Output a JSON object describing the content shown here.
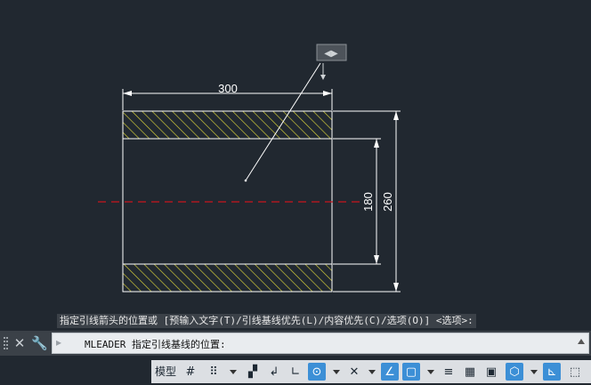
{
  "drawing": {
    "dim_width": "300",
    "dim_inner_height": "180",
    "dim_outer_height": "260",
    "grip_arrows": "◀▶"
  },
  "command": {
    "history_prompt": "指定引线箭头的位置或 [预输入文字(T)/引线基线优先(L)/内容优先(C)/选项(O)] <选项>:",
    "current_input": "MLEADER 指定引线基线的位置:",
    "close_symbol": "✕",
    "customize_symbol": "🔧",
    "recent_symbol": "▸"
  },
  "statusbar": {
    "model_label": "模型",
    "grid_glyph": "#",
    "snap_glyph": "⠿",
    "ortho_glyph": "∟",
    "polar_glyph": "⊙",
    "osnap_glyph": "▢",
    "lineweight_glyph": "≡",
    "transparency_glyph": "▦",
    "annotate_glyph": "⬚"
  },
  "colors": {
    "canvas": "#212830",
    "hatch": "#d8d23a",
    "centerline": "#c8141e",
    "line": "#ffffff",
    "status_active": "#3c8fd6"
  }
}
